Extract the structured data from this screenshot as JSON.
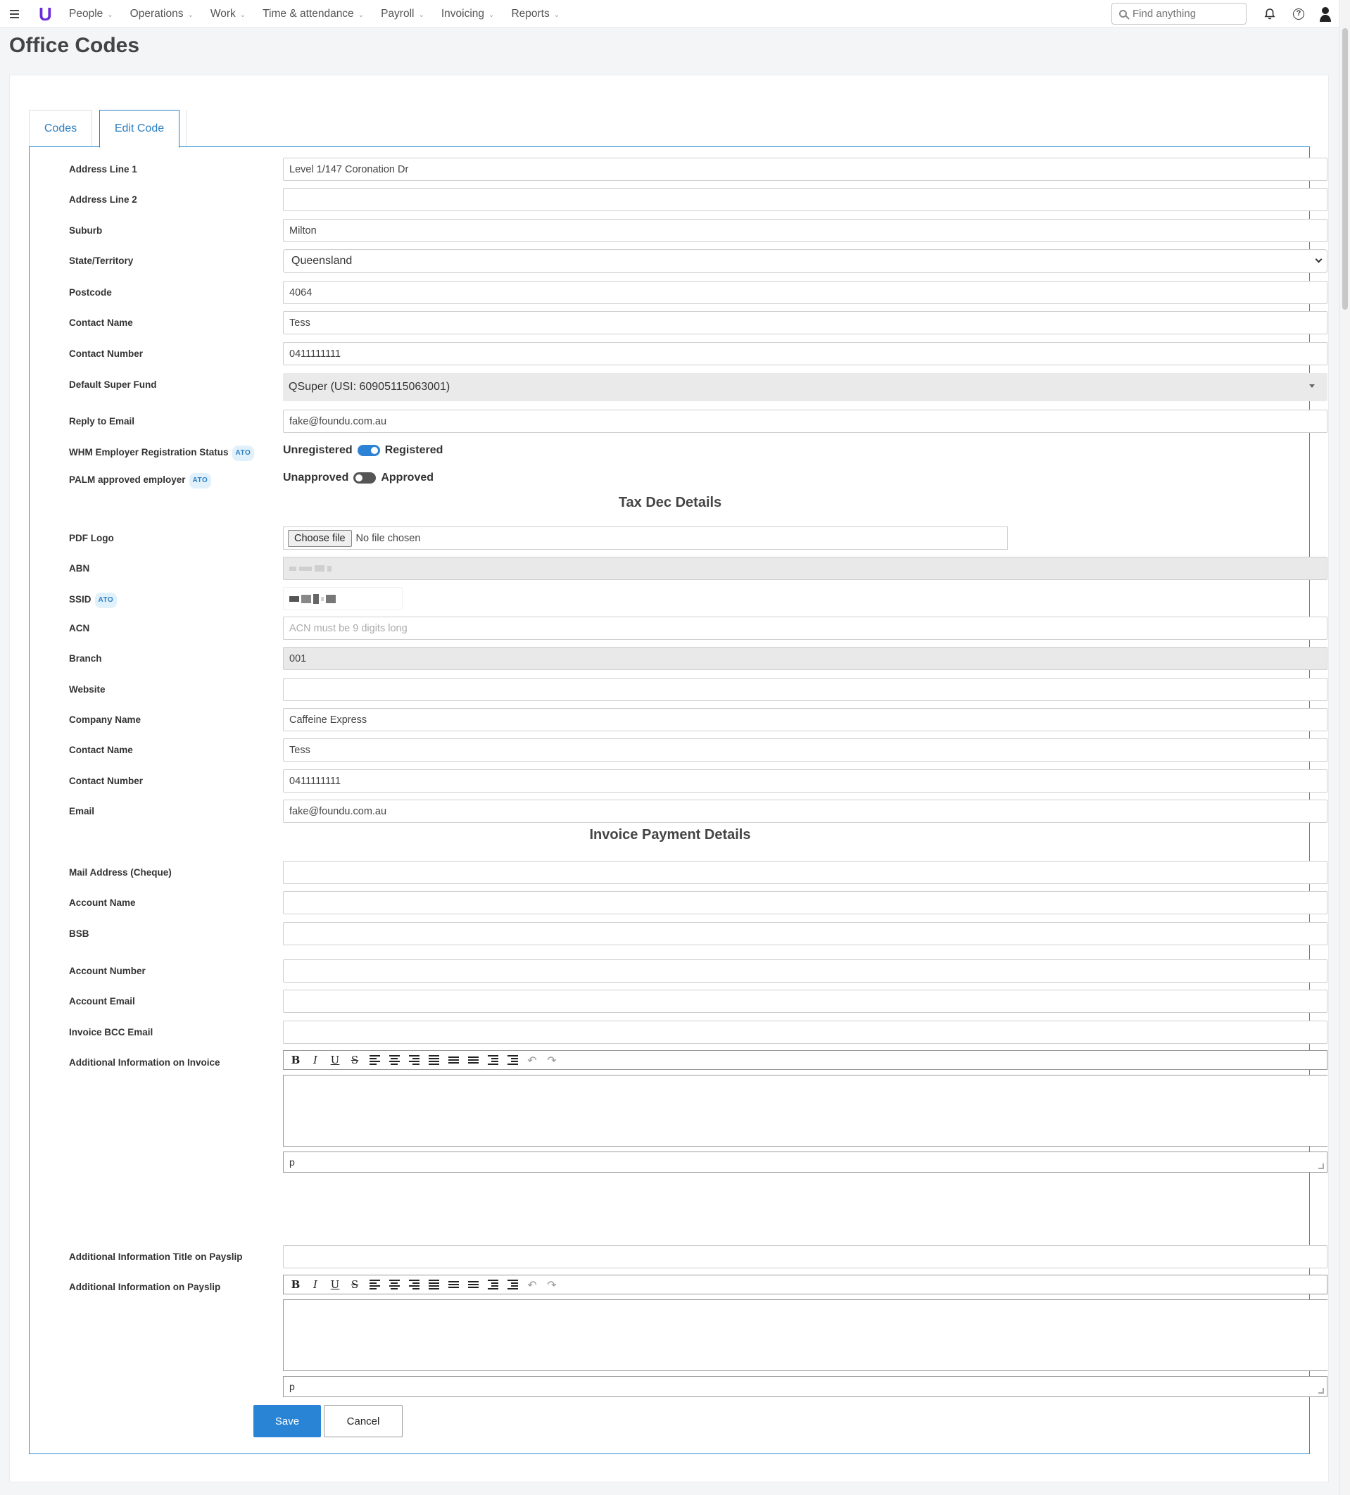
{
  "nav": {
    "items": [
      "People",
      "Operations",
      "Work",
      "Time & attendance",
      "Payroll",
      "Invoicing",
      "Reports"
    ],
    "search_placeholder": "Find anything"
  },
  "page": {
    "title": "Office Codes"
  },
  "tabs": {
    "codes": "Codes",
    "edit": "Edit Code"
  },
  "badge": "ATO",
  "form": {
    "address1": {
      "label": "Address Line 1",
      "value": "Level 1/147 Coronation Dr"
    },
    "address2": {
      "label": "Address Line 2",
      "value": ""
    },
    "suburb": {
      "label": "Suburb",
      "value": "Milton"
    },
    "state": {
      "label": "State/Territory",
      "value": "Queensland"
    },
    "postcode": {
      "label": "Postcode",
      "value": "4064"
    },
    "contact_name": {
      "label": "Contact Name",
      "value": "Tess"
    },
    "contact_number": {
      "label": "Contact Number",
      "value": "0411111111"
    },
    "super_fund": {
      "label": "Default Super Fund",
      "value": "QSuper (USI: 60905115063001)"
    },
    "reply_email": {
      "label": "Reply to Email",
      "value": "fake@foundu.com.au"
    },
    "whm": {
      "label": "WHM Employer Registration Status",
      "off_label": "Unregistered",
      "on_label": "Registered",
      "checked": true
    },
    "palm": {
      "label": "PALM approved employer",
      "off_label": "Unapproved",
      "on_label": "Approved",
      "checked": false
    }
  },
  "tax_section": {
    "title": "Tax Dec Details",
    "pdf_logo": {
      "label": "PDF Logo",
      "button": "Choose file",
      "status": "No file chosen"
    },
    "abn": {
      "label": "ABN"
    },
    "ssid": {
      "label": "SSID"
    },
    "acn": {
      "label": "ACN",
      "placeholder": "ACN must be 9 digits long",
      "value": ""
    },
    "branch": {
      "label": "Branch",
      "value": "001"
    },
    "website": {
      "label": "Website",
      "value": ""
    },
    "company": {
      "label": "Company Name",
      "value": "Caffeine Express"
    },
    "contact_name": {
      "label": "Contact Name",
      "value": "Tess"
    },
    "contact_number": {
      "label": "Contact Number",
      "value": "0411111111"
    },
    "email": {
      "label": "Email",
      "value": "fake@foundu.com.au"
    }
  },
  "invoice_section": {
    "title": "Invoice Payment Details",
    "mail_address": {
      "label": "Mail Address (Cheque)",
      "value": ""
    },
    "account_name": {
      "label": "Account Name",
      "value": ""
    },
    "bsb": {
      "label": "BSB",
      "value": ""
    },
    "account_number": {
      "label": "Account Number",
      "value": ""
    },
    "account_email": {
      "label": "Account Email",
      "value": ""
    },
    "bcc_email": {
      "label": "Invoice BCC Email",
      "value": ""
    },
    "additional_invoice": {
      "label": "Additional Information on Invoice",
      "path": "p"
    },
    "payslip_title": {
      "label": "Additional Information Title on Payslip",
      "value": ""
    },
    "additional_payslip": {
      "label": "Additional Information on Payslip",
      "path": "p"
    }
  },
  "editor": {
    "bold": "B",
    "italic": "I",
    "underline": "U",
    "strike": "S"
  },
  "actions": {
    "save": "Save",
    "cancel": "Cancel"
  }
}
